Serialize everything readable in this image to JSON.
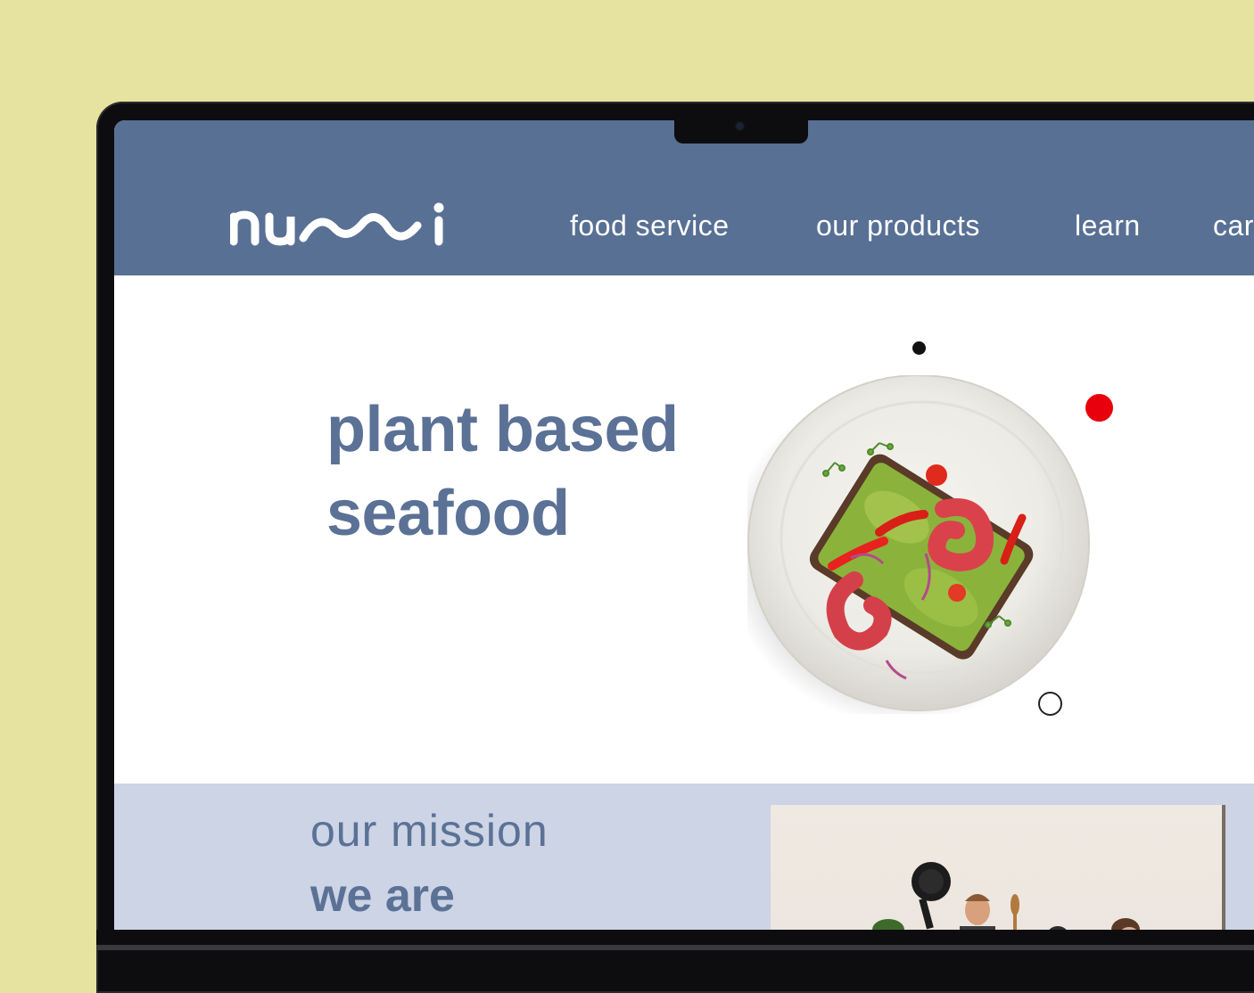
{
  "brand": {
    "logo_text": "numi",
    "colors": {
      "header": "#587094",
      "accent_text": "#5b7196",
      "mission_band": "#ccd4e5",
      "page_background": "#e6e29f",
      "red_dot": "#e8000d"
    }
  },
  "nav": {
    "items": [
      {
        "label": "food service"
      },
      {
        "label": "our products"
      },
      {
        "label": "learn"
      },
      {
        "label": "car"
      }
    ]
  },
  "hero": {
    "title_line1": "plant based",
    "title_line2": "seafood",
    "image": "plate-with-plant-based-shrimp-toast"
  },
  "mission": {
    "label": "our mission",
    "heading": "we are",
    "image": "people-in-kitchen-photo"
  },
  "icons": [
    "camera-icon"
  ]
}
